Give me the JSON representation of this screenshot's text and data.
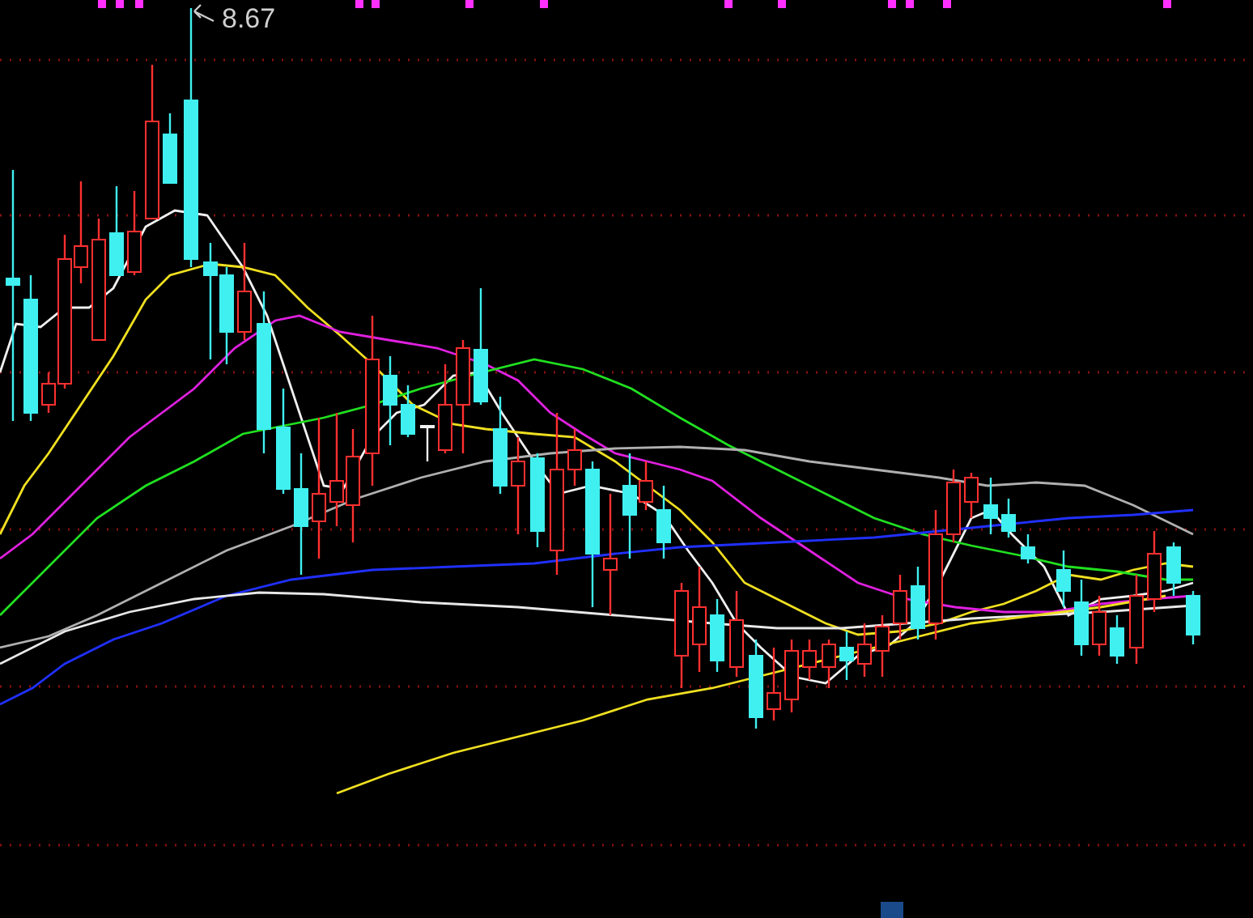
{
  "chart": {
    "high_label": "8.67"
  }
}
